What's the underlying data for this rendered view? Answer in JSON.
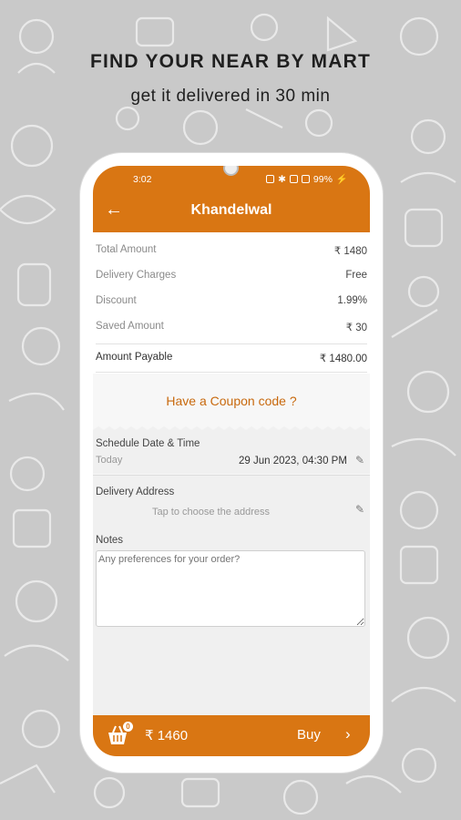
{
  "promo": {
    "title": "FIND YOUR NEAR BY MART",
    "subtitle": "get it delivered in 30 min"
  },
  "status_bar": {
    "time": "3:02",
    "battery": "99%"
  },
  "app_bar": {
    "title": "Khandelwal",
    "back_icon": "arrow-left-icon"
  },
  "summary": {
    "rows": [
      {
        "label": "Total Amount",
        "value": "₹ 1480"
      },
      {
        "label": "Delivery Charges",
        "value": "Free"
      },
      {
        "label": "Discount",
        "value": "1.99%"
      },
      {
        "label": "Saved Amount",
        "value": "₹ 30"
      }
    ],
    "payable_label": "Amount Payable",
    "payable_value": "₹ 1480.00"
  },
  "coupon_text": "Have a Coupon code ?",
  "schedule": {
    "title": "Schedule Date & Time",
    "day": "Today",
    "datetime": "29 Jun 2023, 04:30 PM"
  },
  "address": {
    "title": "Delivery Address",
    "placeholder": "Tap to choose the address"
  },
  "notes": {
    "title": "Notes",
    "placeholder": "Any preferences for your order?"
  },
  "bottom_bar": {
    "cart_count": "0",
    "total": "₹ 1460",
    "buy_label": "Buy"
  },
  "colors": {
    "accent": "#d97613",
    "coupon": "#c8690d",
    "background": "#c9c9c9"
  }
}
